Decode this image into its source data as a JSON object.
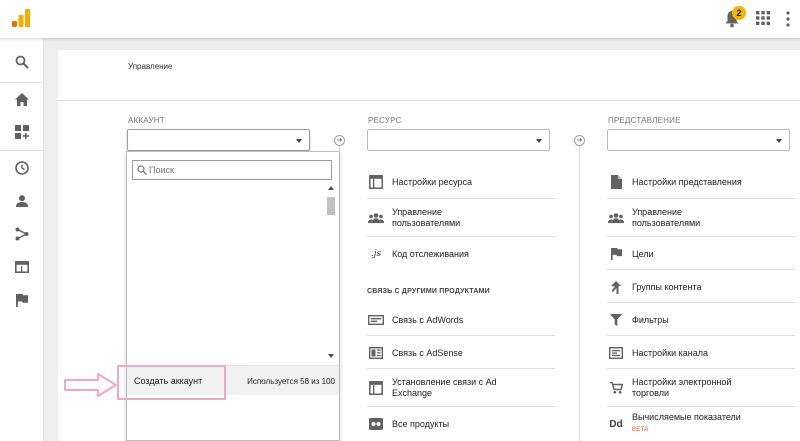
{
  "header": {
    "notification_count": "2"
  },
  "page": {
    "title": "Управление"
  },
  "columns": {
    "account": {
      "label": "АККАУНТ",
      "selected": ""
    },
    "property": {
      "label": "РЕСУРС",
      "selected": ""
    },
    "view": {
      "label": "ПРЕДСТАВЛЕНИЕ",
      "selected": ""
    }
  },
  "dropdown": {
    "search_placeholder": "Поиск",
    "create_label": "Создать аккаунт",
    "usage_text": "Используется 58 из 100"
  },
  "property_items": [
    {
      "label": "Настройки ресурса",
      "icon": "layout-icon"
    },
    {
      "label": "Управление пользователями",
      "icon": "users-icon"
    },
    {
      "label": "Код отслеживания",
      "icon": "js-icon"
    },
    {
      "label": "Связь с AdWords",
      "icon": "adwords-icon"
    },
    {
      "label": "Связь с AdSense",
      "icon": "adsense-icon"
    },
    {
      "label": "Установление связи с Ad Exchange",
      "icon": "adexchange-icon"
    },
    {
      "label": "Все продукты",
      "icon": "products-icon"
    }
  ],
  "property_section": "СВЯЗЬ С ДРУГИМИ ПРОДУКТАМИ",
  "view_items": [
    {
      "label": "Настройки представления",
      "icon": "doc-icon"
    },
    {
      "label": "Управление пользователями",
      "icon": "users-icon"
    },
    {
      "label": "Цели",
      "icon": "flag-icon"
    },
    {
      "label": "Группы контента",
      "icon": "content-groups-icon"
    },
    {
      "label": "Фильтры",
      "icon": "filter-icon"
    },
    {
      "label": "Настройки канала",
      "icon": "channel-icon"
    },
    {
      "label": "Настройки электронной торговли",
      "icon": "cart-icon"
    },
    {
      "label": "Вычисляемые показатели",
      "icon": "dd-icon",
      "badge": "BETA"
    }
  ],
  "colors": {
    "accent": "#f4b400",
    "annotation": "#f4a6c9",
    "beta": "#e65100"
  }
}
